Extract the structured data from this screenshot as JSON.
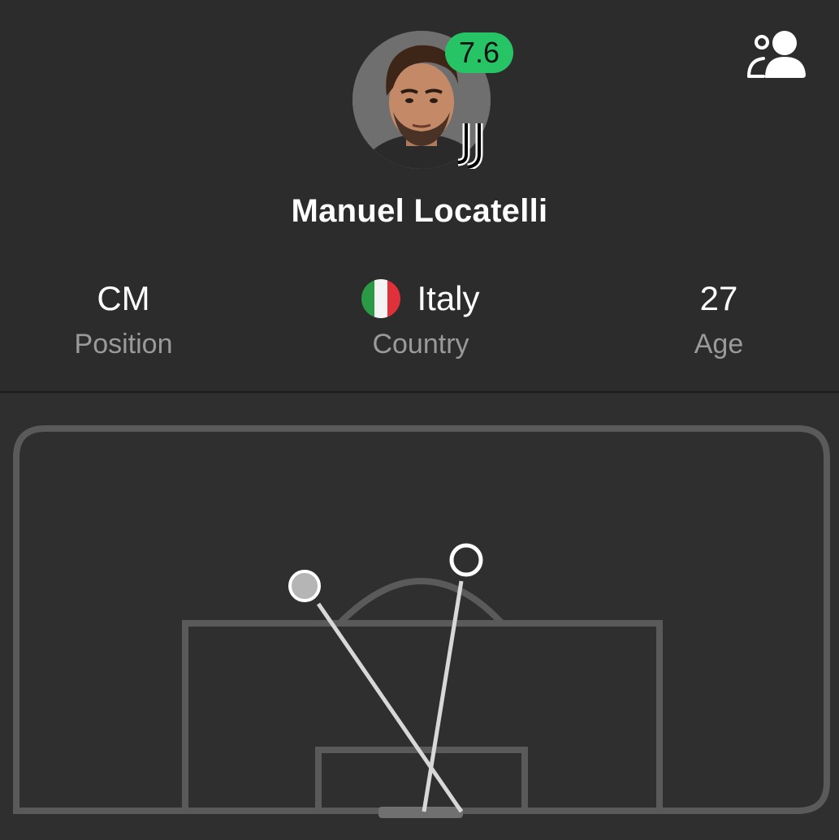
{
  "player": {
    "name": "Manuel Locatelli",
    "rating": "7.6",
    "rating_color": "#27c465",
    "club_logo_icon": "juventus-logo"
  },
  "stats": {
    "position": {
      "value": "CM",
      "label": "Position"
    },
    "country": {
      "value": "Italy",
      "label": "Country",
      "flag_icon": "italy-flag-icon"
    },
    "age": {
      "value": "27",
      "label": "Age"
    }
  },
  "header": {
    "profile_icon": "user-profile-icon"
  },
  "shot_map": {
    "shots": [
      {
        "outcome": "blocked",
        "marker": "filled-circle",
        "color": "#b5b5b5"
      },
      {
        "outcome": "on-target",
        "marker": "hollow-circle",
        "color": "#ffffff"
      }
    ],
    "colors": {
      "pitch_lines": "#5a5a5a",
      "trajectory": "#d8d8d8"
    }
  }
}
